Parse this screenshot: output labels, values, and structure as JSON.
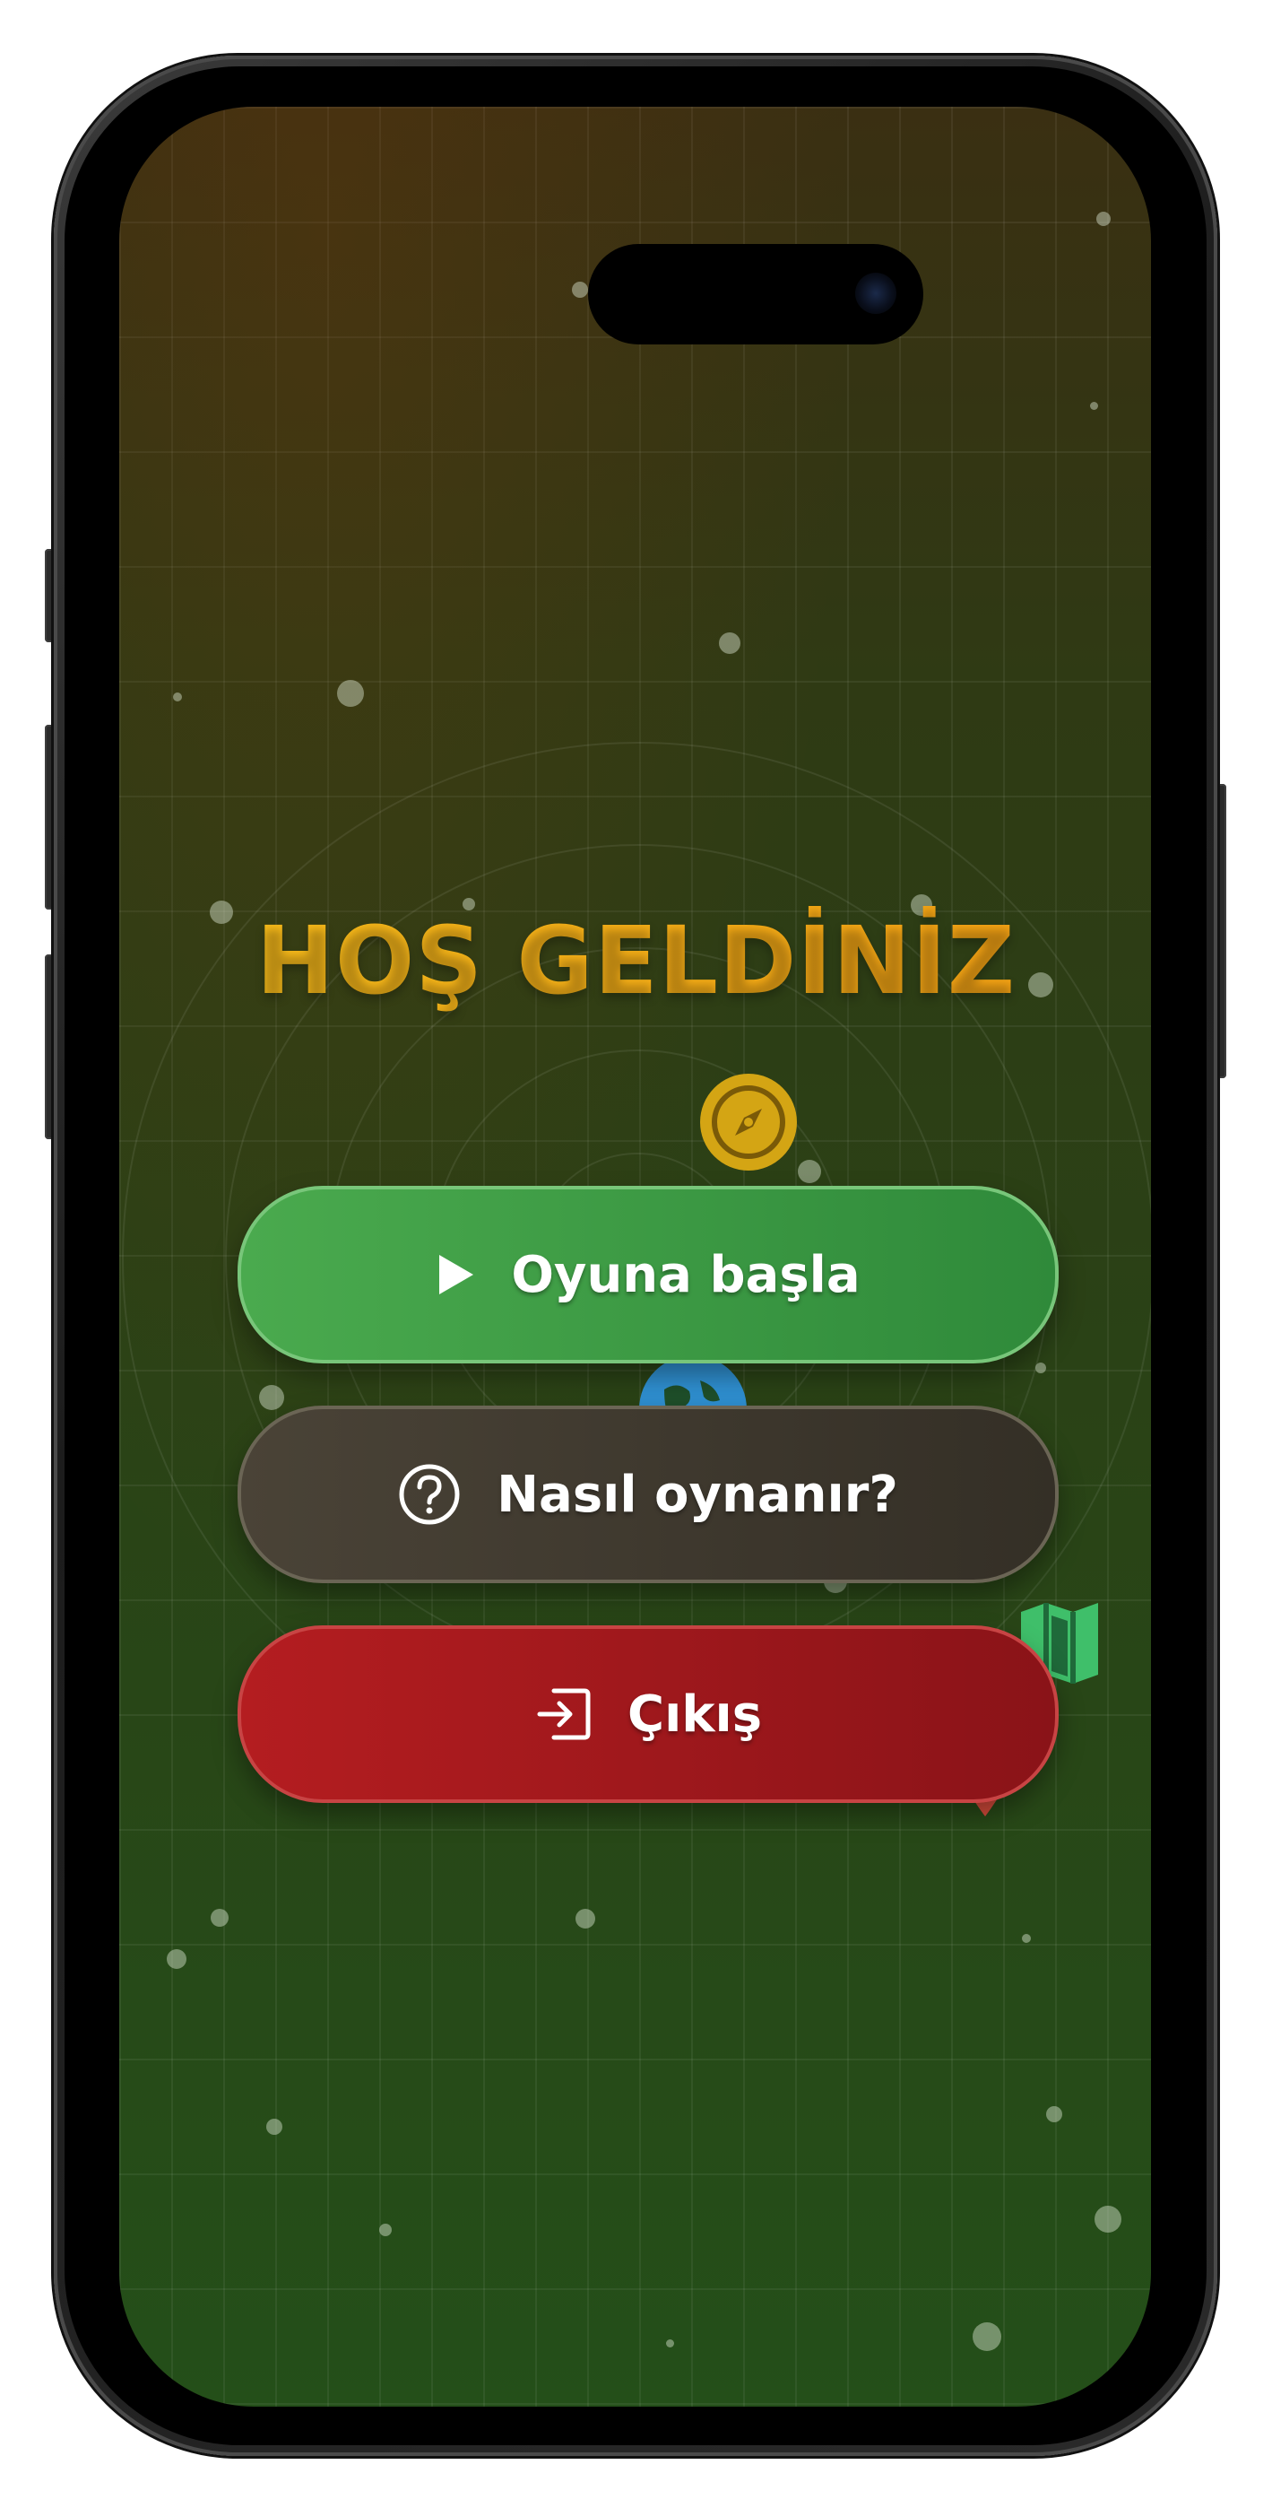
{
  "screen": {
    "title": "HOŞ GELDİNİZ",
    "title_gradient": [
      "#f7c21c",
      "#f39a12"
    ],
    "background": {
      "top": "#3a2f12",
      "bottom": "#244f19"
    }
  },
  "menu": {
    "play": {
      "label": "Oyuna başla",
      "icon": "play-icon",
      "color": "#3a9a44"
    },
    "help": {
      "label": "Nasıl oynanır?",
      "icon": "question-circle-icon",
      "color": "#3e3930"
    },
    "exit": {
      "label": "Çıkış",
      "icon": "exit-icon",
      "color": "#a0181c"
    }
  },
  "decorations": {
    "icons": [
      "compass-icon",
      "globe-icon",
      "map-icon",
      "map-pin-icon"
    ],
    "colors": {
      "compass": "#d4a514",
      "globe": "#2f8fd0",
      "map": "#3fbf6a",
      "pin": "#d24a3a"
    }
  }
}
